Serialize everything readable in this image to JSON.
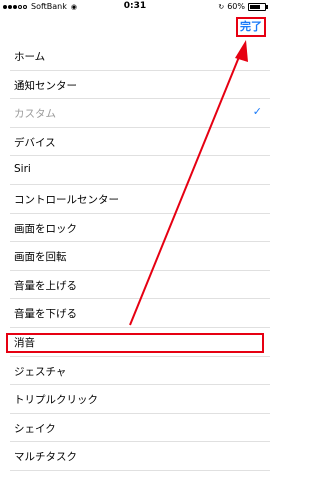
{
  "status_bar": {
    "carrier": "SoftBank",
    "time": "0:31",
    "battery": "60%",
    "battery_level": 0.6
  },
  "nav": {
    "done_label": "完了"
  },
  "menu": {
    "items": [
      {
        "label": "ホーム"
      },
      {
        "label": "通知センター"
      },
      {
        "label": "カスタム"
      },
      {
        "label": "デバイス"
      },
      {
        "label": "Siri"
      },
      {
        "label": "コントロールセンター"
      },
      {
        "label": "画面をロック"
      },
      {
        "label": "画面を回転"
      },
      {
        "label": "音量を上げる"
      },
      {
        "label": "音量を下げる"
      },
      {
        "label": "消音"
      },
      {
        "label": "ジェスチャ"
      },
      {
        "label": "トリプルクリック"
      },
      {
        "label": "シェイク"
      },
      {
        "label": "マルチタスク"
      }
    ]
  },
  "colors": {
    "accent": "#1a7af8",
    "annotation": "#e60012",
    "disabled_text": "#9b9b9b"
  }
}
